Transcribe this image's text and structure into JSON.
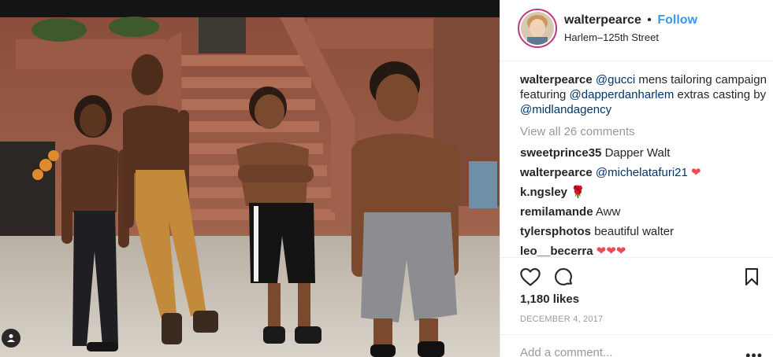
{
  "header": {
    "username": "walterpearce",
    "separator": "•",
    "follow_label": "Follow",
    "location": "Harlem–125th Street"
  },
  "caption": {
    "username": "walterpearce",
    "parts": [
      "@gucci",
      " mens tailoring campaign featuring ",
      "@dapperdanharlem",
      " extras casting by ",
      "@midlandagency"
    ]
  },
  "view_all_comments": "View all 26 comments",
  "comments": [
    {
      "username": "sweetprince35",
      "text": "Dapper Walt",
      "emoji": ""
    },
    {
      "username": "walterpearce",
      "text": "@michelatafuri21",
      "emoji": "heart"
    },
    {
      "username": "k.ngsley",
      "text": "",
      "emoji": "rose"
    },
    {
      "username": "remilamande",
      "text": "Aww",
      "emoji": ""
    },
    {
      "username": "tylersphotos",
      "text": "beautiful walter",
      "emoji": ""
    },
    {
      "username": "leo__becerra",
      "text": "",
      "emoji": "hearts3"
    }
  ],
  "actions": {
    "icons": [
      "heart-icon",
      "comment-icon",
      "bookmark-icon"
    ]
  },
  "likes": "1,180 likes",
  "date": "DECEMBER 4, 2017",
  "add_comment_placeholder": "Add a comment...",
  "more_label": "•••",
  "colors": {
    "link": "#3897f0",
    "mention": "#003569",
    "muted": "#999999",
    "heart": "#ed4956",
    "avatar_ring": "#c13584"
  }
}
